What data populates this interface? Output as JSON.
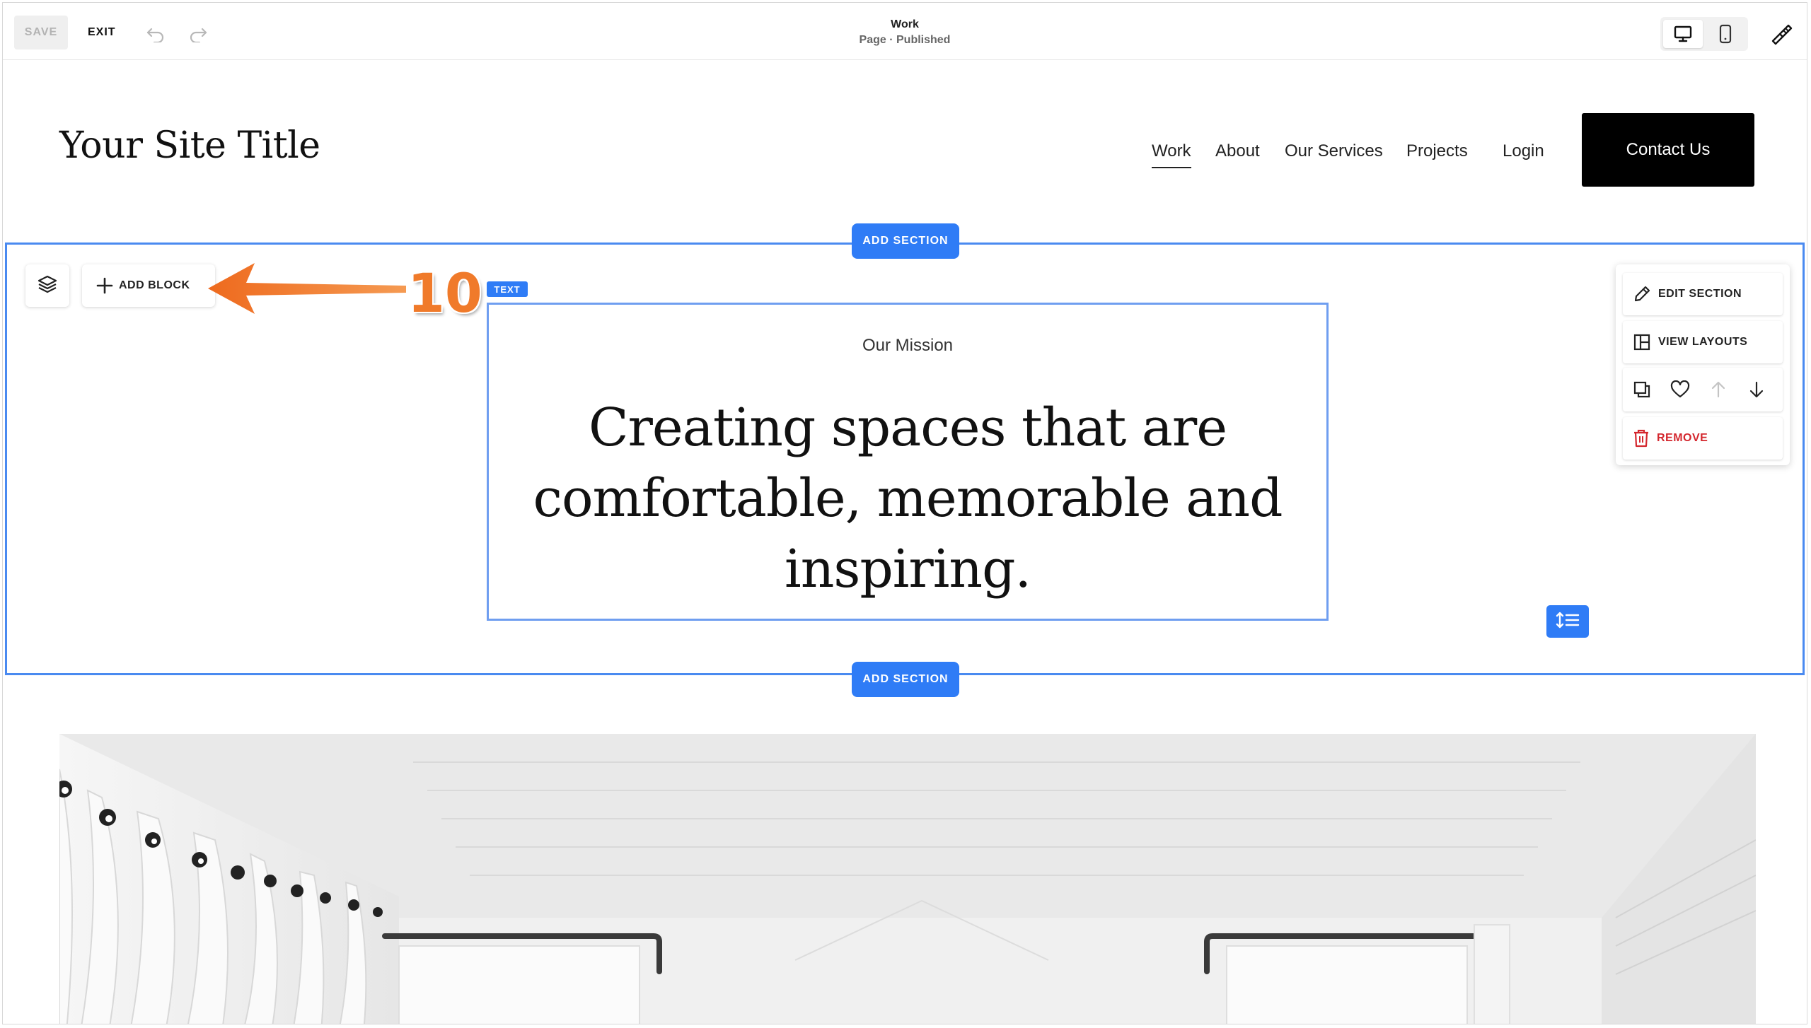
{
  "toolbar": {
    "save_label": "SAVE",
    "exit_label": "EXIT",
    "page_title": "Work",
    "page_status": "Page · Published",
    "icons": [
      "undo-icon",
      "redo-icon",
      "desktop-icon",
      "mobile-icon",
      "site-styles-icon"
    ]
  },
  "site": {
    "title": "Your Site Title",
    "nav": [
      "Work",
      "About",
      "Our Services",
      "Projects",
      "Login"
    ],
    "cta_label": "Contact Us"
  },
  "editor": {
    "add_section_label": "ADD SECTION",
    "add_block_label": "ADD BLOCK",
    "text_badge": "TEXT",
    "annotation_step": "10",
    "accent_color": "#2f7cf6",
    "annotation_color": "#f07a2a"
  },
  "content": {
    "mission_label": "Our Mission",
    "headline": "Creating spaces that are comfortable, memorable and inspiring."
  },
  "section_menu": {
    "edit_label": "EDIT SECTION",
    "layouts_label": "VIEW LAYOUTS",
    "remove_label": "REMOVE",
    "remove_color": "#d4272e"
  }
}
